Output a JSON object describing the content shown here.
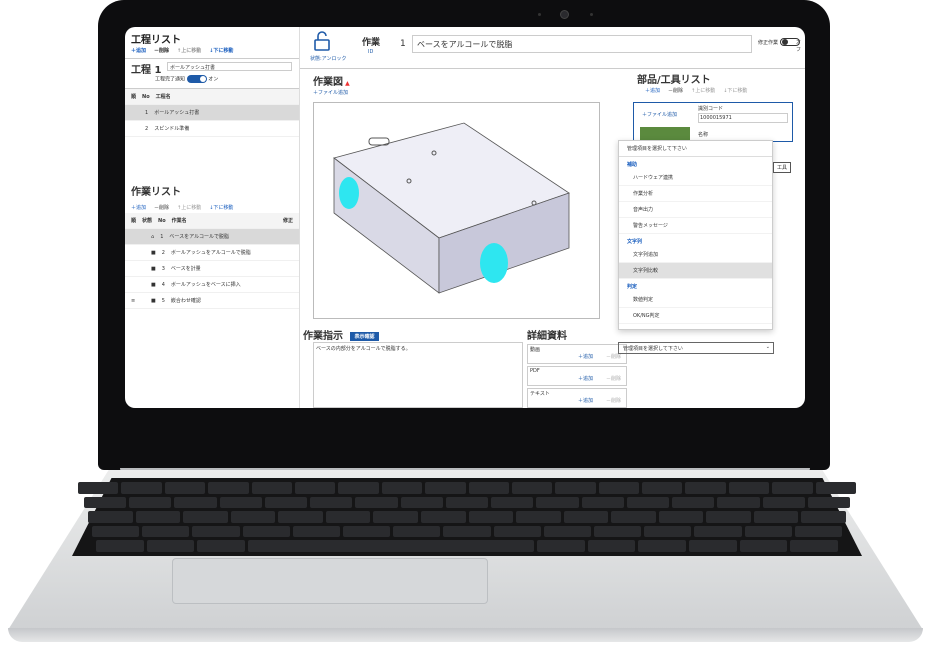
{
  "left": {
    "process_title": "工程リスト",
    "tools": {
      "add": "＋追加",
      "del": "－削除",
      "up": "↑上に移動",
      "down": "↓下に移動"
    },
    "process_no": "工程  1",
    "process_name": "ボールアッシュ打書",
    "complete_label": "工程完了通知",
    "toggle_on": "オン",
    "table_header": [
      "順",
      "No",
      "工程名"
    ],
    "process_rows": [
      {
        "no": "1",
        "name": "ボールアッシュ打書"
      },
      {
        "no": "2",
        "name": "スピンドル準備"
      }
    ],
    "work_title": "作業リスト",
    "work_header": [
      "順",
      "状態",
      "No",
      "作業名",
      "修正"
    ],
    "work_rows": [
      {
        "no": "1",
        "name": "ベースをアルコールで脱脂"
      },
      {
        "no": "2",
        "name": "ボールアッシュをアルコールで脱脂"
      },
      {
        "no": "3",
        "name": "ベースを計量"
      },
      {
        "no": "4",
        "name": "ボールアッシュをベースに挿入"
      },
      {
        "no": "5",
        "name": "嵌合わせ確認"
      }
    ]
  },
  "top": {
    "lock_label": "状態:アンロック",
    "work_label": "作業",
    "work_id": "ID",
    "work_no": "1",
    "work_name": "ベースをアルコールで脱脂",
    "correct_label": "修正作業",
    "toggle_off": "オフ"
  },
  "center": {
    "figure_title": "作業図",
    "file_add": "＋ファイル追加",
    "instruction_title": "作業指示",
    "show_confirm": "表示確認",
    "instruction_text": "ベースの内部分をアルコールで脱脂する。",
    "detail_title": "詳細資料",
    "detail_rows": [
      {
        "label": "動画",
        "add": "＋追加",
        "del": "－削除"
      },
      {
        "label": "PDF",
        "add": "＋追加",
        "del": "－削除"
      },
      {
        "label": "テキスト",
        "add": "＋追加",
        "del": "－削除"
      }
    ]
  },
  "right": {
    "title": "部品/工具リスト",
    "tools": {
      "add": "＋追加",
      "del": "－削除",
      "up": "↑上に移動",
      "down": "↓下に移動"
    },
    "file_add": "＋ファイル追加",
    "code_label": "識別コード",
    "code_value": "1000015971",
    "name_label": "名称",
    "tool_label": "工具",
    "dropdown_prompt": "管理項目を選択して下さい",
    "groups": [
      {
        "name": "補助",
        "items": [
          "ハードウェア連携",
          "作業分析",
          "音声出力",
          "警告メッセージ"
        ]
      },
      {
        "name": "文字列",
        "items": [
          "文字列追加",
          "文字列比較"
        ]
      },
      {
        "name": "判定",
        "items": [
          "数値判定",
          "OK/NG判定"
        ]
      }
    ],
    "highlighted": "文字列比較",
    "select_value": "管理項目を選択して下さい"
  },
  "colors": {
    "accent": "#1e5aa8",
    "highlight": "#d9d9d9",
    "cyan": "#2ee6f0"
  }
}
